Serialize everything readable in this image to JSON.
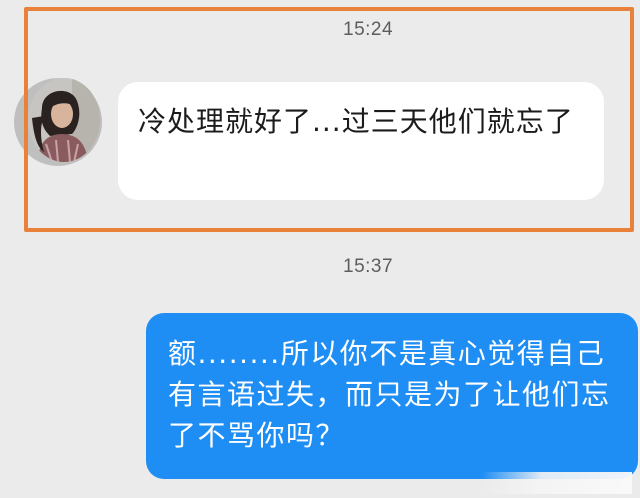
{
  "chat": {
    "messages": [
      {
        "timestamp": "15:24",
        "sender": "other",
        "text": "冷处理就好了...过三天他们就忘了",
        "highlighted": true
      },
      {
        "timestamp": "15:37",
        "sender": "self",
        "text": "额........所以你不是真心觉得自己有言语过失，而只是为了让他们忘了不骂你吗？"
      }
    ]
  },
  "colors": {
    "background": "#ebebeb",
    "incoming_bubble": "#ffffff",
    "outgoing_bubble": "#1f8ef4",
    "highlight_border": "#e8823b"
  }
}
